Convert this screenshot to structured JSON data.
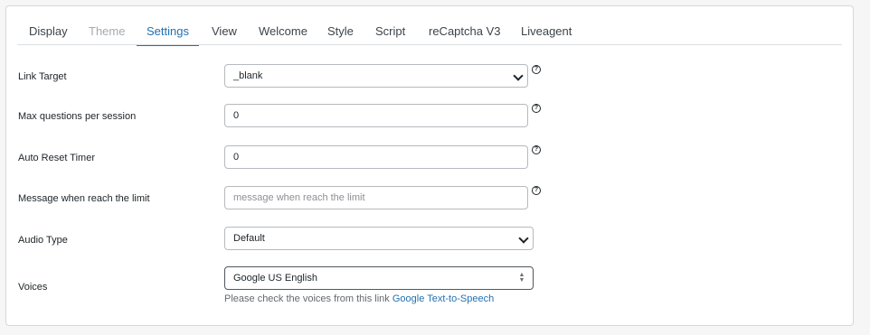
{
  "tabs": [
    {
      "label": "Display"
    },
    {
      "label": "Theme"
    },
    {
      "label": "Settings"
    },
    {
      "label": "View"
    },
    {
      "label": "Welcome"
    },
    {
      "label": "Style"
    },
    {
      "label": "Script"
    },
    {
      "label": "reCaptcha V3"
    },
    {
      "label": "Liveagent"
    }
  ],
  "active_tab": "Settings",
  "fields": {
    "link_target": {
      "label": "Link Target",
      "value": "_blank"
    },
    "max_questions": {
      "label": "Max questions per session",
      "value": "0"
    },
    "auto_reset": {
      "label": "Auto Reset Timer",
      "value": "0"
    },
    "limit_message": {
      "label": "Message when reach the limit",
      "value": "",
      "placeholder": "message when reach the limit"
    },
    "audio_type": {
      "label": "Audio Type",
      "value": "Default"
    },
    "voices": {
      "label": "Voices",
      "value": "Google US English",
      "hint_text": "Please check the voices from this link",
      "hint_link": "Google Text-to-Speech"
    }
  },
  "help_glyph": "?",
  "icons": {
    "help": "question-circle-icon",
    "select": "chevron-down-icon",
    "stepper": "up-down-stepper-icon"
  },
  "colors": {
    "accent": "#2271b1",
    "disabled_tab": "#a7aaad"
  }
}
